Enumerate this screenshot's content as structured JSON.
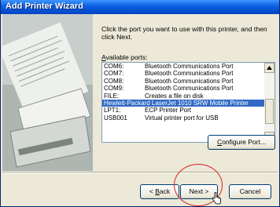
{
  "window": {
    "title": "Add Printer Wizard"
  },
  "intro_text": "Click the port you want to use with this printer, and then click Next.",
  "ports_label": {
    "prefix": "A",
    "rest": "vailable ports:"
  },
  "ports": [
    {
      "port": "COM6:",
      "description": "Bluetooth Communications Port",
      "selected": false
    },
    {
      "port": "COM7:",
      "description": "Bluetooth Communications Port",
      "selected": false
    },
    {
      "port": "COM8:",
      "description": "Bluetooth Communications Port",
      "selected": false
    },
    {
      "port": "COM9:",
      "description": "Bluetooth Communications Port",
      "selected": false
    },
    {
      "port": "FILE:",
      "description": "Creates a file on disk",
      "selected": false
    },
    {
      "port": "Hewlett-Packard LaserJet 1010 SRW Mobile Printer",
      "description": "",
      "selected": true
    },
    {
      "port": "LPT1:",
      "description": "ECP Printer Port",
      "selected": false
    },
    {
      "port": "USB001",
      "description": "Virtual printer port for USB",
      "selected": false
    }
  ],
  "buttons": {
    "configure": {
      "prefix": "",
      "mnemonic": "C",
      "rest": "onfigure Port..."
    },
    "back": {
      "prefix": "< ",
      "mnemonic": "B",
      "rest": "ack"
    },
    "next": {
      "label": "Next >"
    },
    "cancel": {
      "label": "Cancel"
    }
  },
  "icons": {
    "scroll_up": "scroll-up-arrow-icon",
    "scroll_down": "scroll-down-arrow-icon",
    "cursor": "hand-cursor-icon"
  },
  "colors": {
    "title_bar": "#0a5fe0",
    "selection": "#316ac5",
    "highlight_circle": "#dd2222"
  }
}
